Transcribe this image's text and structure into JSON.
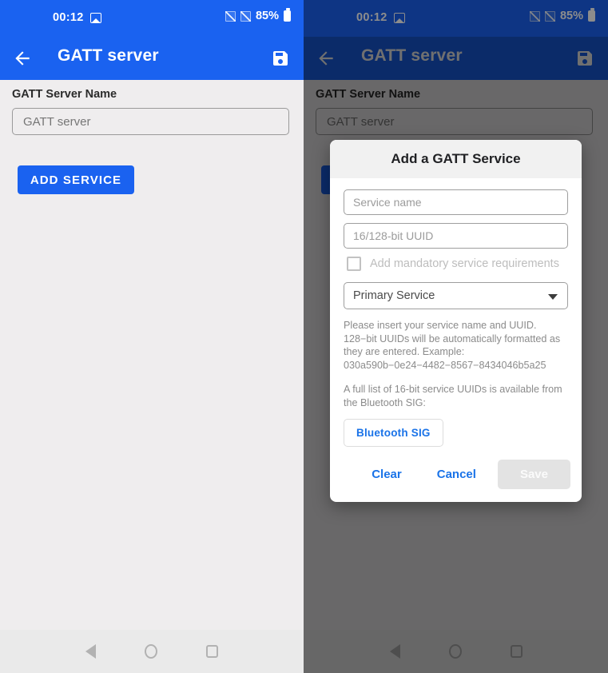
{
  "status_bar": {
    "time": "00:12",
    "battery_percent": "85%",
    "photo_icon": "image-icon",
    "signal_icon": "no-signal-icon",
    "battery_icon": "battery-icon"
  },
  "app_bar": {
    "title": "GATT server",
    "back_icon": "back-arrow-icon",
    "save_icon": "save-floppy-icon"
  },
  "form": {
    "label": "GATT Server Name",
    "name_placeholder": "GATT server",
    "name_value": "",
    "add_service_label": "ADD SERVICE"
  },
  "nav_bar": {
    "back": "nav-back-icon",
    "home": "nav-home-icon",
    "recents": "nav-recents-icon"
  },
  "dialog": {
    "title": "Add a GATT Service",
    "service_name_placeholder": "Service name",
    "service_name_value": "",
    "uuid_placeholder": "16/128-bit UUID",
    "uuid_value": "",
    "checkbox_label": "Add mandatory service requirements",
    "checkbox_checked": false,
    "service_type_selected": "Primary Service",
    "help_text": "Please insert your service name and UUID. 128−bit UUIDs will be automatically formatted as they are entered. Example: 030a590b−0e24−4482−8567−8434046b5a25",
    "help_text_2": "A full list of 16-bit service UUIDs is available from the Bluetooth SIG:",
    "sig_button_label": "Bluetooth SIG",
    "clear_label": "Clear",
    "cancel_label": "Cancel",
    "save_label": "Save",
    "save_enabled": false
  },
  "colors": {
    "primary_blue": "#1a62f0",
    "link_blue": "#1a73e8",
    "page_bg": "#efedee",
    "nav_bg": "#eaeaea",
    "dialog_header_bg": "#f1f1f1"
  }
}
